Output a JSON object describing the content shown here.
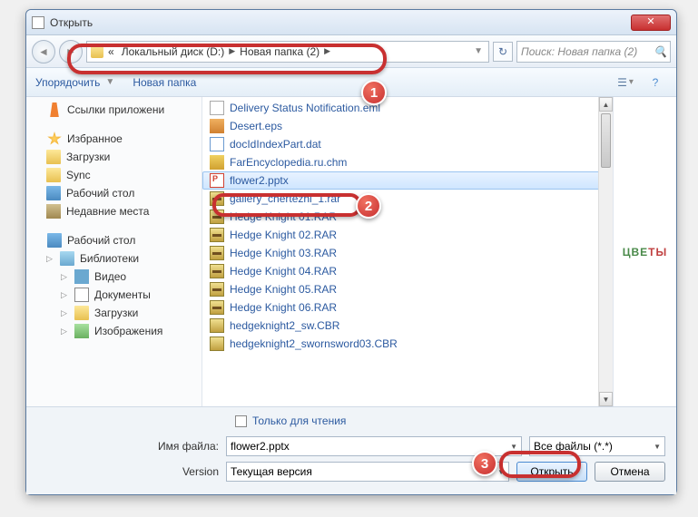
{
  "window": {
    "title": "Открыть"
  },
  "breadcrumb": {
    "prefix": "«",
    "seg1": "Локальный диск (D:)",
    "seg2": "Новая папка (2)"
  },
  "search": {
    "placeholder": "Поиск: Новая папка (2)"
  },
  "toolbar": {
    "organize": "Упорядочить",
    "newfolder": "Новая папка"
  },
  "sidebar": {
    "apps": "Ссылки приложени",
    "favorites": "Избранное",
    "downloads": "Загрузки",
    "sync": "Sync",
    "desktop1": "Рабочий стол",
    "recent": "Недавние места",
    "desktop2": "Рабочий стол",
    "libraries": "Библиотеки",
    "video": "Видео",
    "documents": "Документы",
    "downloads2": "Загрузки",
    "images": "Изображения"
  },
  "files": [
    {
      "name": "Delivery Status Notification.eml",
      "icon": "f-eml"
    },
    {
      "name": "Desert.eps",
      "icon": "f-eps"
    },
    {
      "name": "docIdIndexPart.dat",
      "icon": "f-dat"
    },
    {
      "name": "FarEncyclopedia.ru.chm",
      "icon": "f-chm"
    },
    {
      "name": "flower2.pptx",
      "icon": "f-pptx",
      "selected": true
    },
    {
      "name": "gallery_chertezhi_1.rar",
      "icon": "f-rar"
    },
    {
      "name": "Hedge Knight 01.RAR",
      "icon": "f-rar"
    },
    {
      "name": "Hedge Knight 02.RAR",
      "icon": "f-rar"
    },
    {
      "name": "Hedge Knight 03.RAR",
      "icon": "f-rar"
    },
    {
      "name": "Hedge Knight 04.RAR",
      "icon": "f-rar"
    },
    {
      "name": "Hedge Knight 05.RAR",
      "icon": "f-rar"
    },
    {
      "name": "Hedge Knight 06.RAR",
      "icon": "f-rar"
    },
    {
      "name": "hedgeknight2_sw.CBR",
      "icon": "f-cbr"
    },
    {
      "name": "hedgeknight2_swornsword03.CBR",
      "icon": "f-cbr"
    }
  ],
  "preview": {
    "text1": "ЦВЕ",
    "text2": "ТЫ"
  },
  "readonly": "Только для чтения",
  "form": {
    "filename_label": "Имя файла:",
    "filename_value": "flower2.pptx",
    "filter": "Все файлы (*.*)",
    "version_label": "Version",
    "version_value": "Текущая версия",
    "open": "Открыть",
    "cancel": "Отмена"
  },
  "badges": {
    "b1": "1",
    "b2": "2",
    "b3": "3"
  }
}
